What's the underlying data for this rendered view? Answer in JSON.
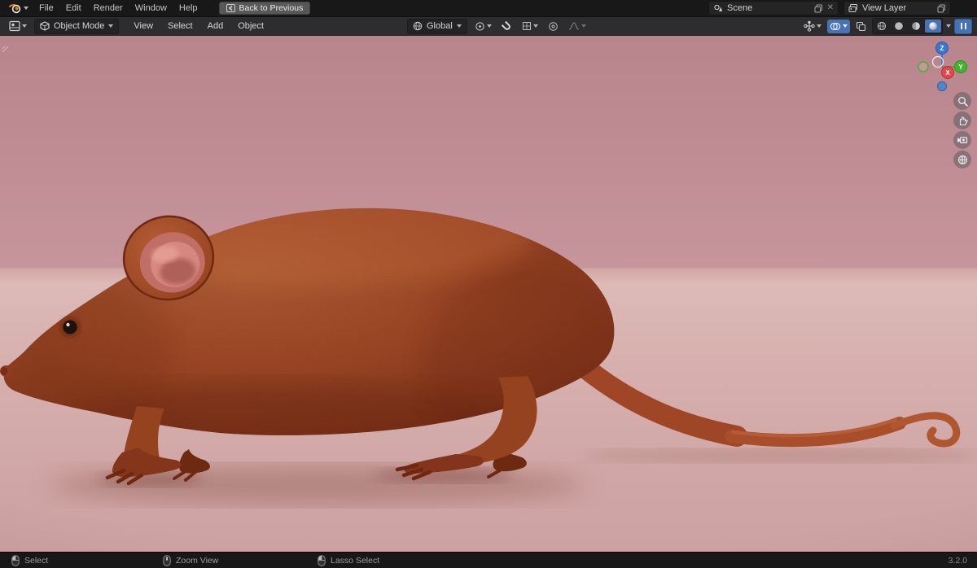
{
  "topbar": {
    "menus": [
      "File",
      "Edit",
      "Render",
      "Window",
      "Help"
    ],
    "back_button": "Back to Previous",
    "scene_selector": "Scene",
    "view_layer_selector": "View Layer"
  },
  "viewport_header": {
    "mode_selector": "Object Mode",
    "menus": [
      "View",
      "Select",
      "Add",
      "Object"
    ],
    "transform_orientation": "Global"
  },
  "gizmo": {
    "x": "X",
    "y": "Y",
    "z": "Z"
  },
  "statusbar": {
    "hints": [
      "Select",
      "Zoom View",
      "Lasso Select"
    ],
    "version": "3.2.0"
  },
  "icons": {
    "close": "✕"
  },
  "colors": {
    "accent_blue": "#4772b3",
    "topbar_bg": "#181818",
    "header_bg": "#2d2d30",
    "wall_pink": "#c6959b",
    "floor_pink": "#dcbab6",
    "rat_body": "#a54b28",
    "rat_ear_inner": "#d6887f",
    "axis_x": "#e5474d",
    "axis_y": "#42b42e",
    "axis_z": "#3d77d6"
  }
}
